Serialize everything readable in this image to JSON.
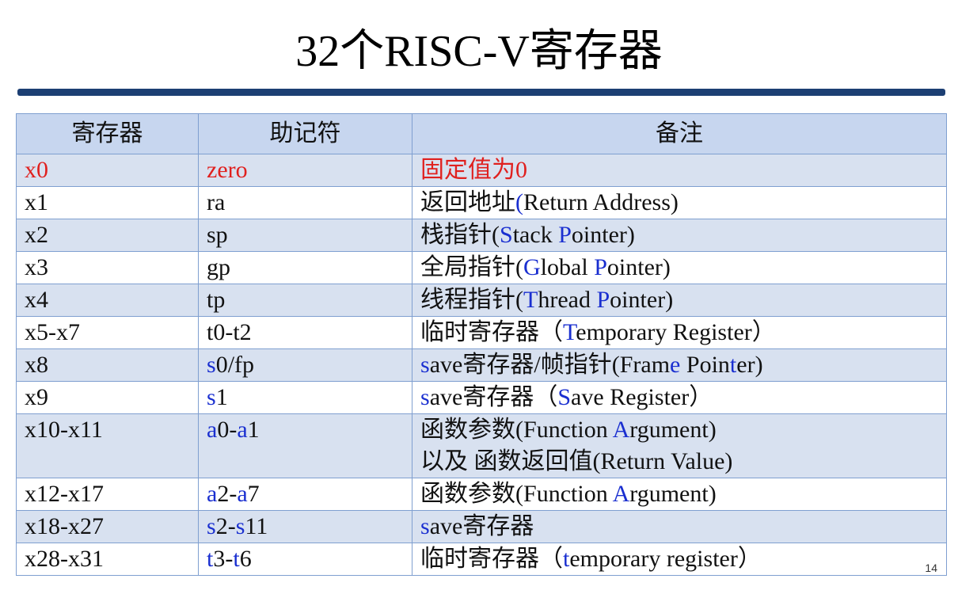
{
  "title": "32个RISC-V寄存器",
  "table": {
    "headers": [
      "寄存器",
      "助记符",
      "备注"
    ],
    "rows": [
      {
        "reg": "x0",
        "mnemonic": "zero",
        "note": "固定值为0"
      },
      {
        "reg": "x1",
        "mnemonic": "ra",
        "note": "返回地址(Return Address)"
      },
      {
        "reg": "x2",
        "mnemonic": "sp",
        "note": "栈指针(Stack Pointer)"
      },
      {
        "reg": "x3",
        "mnemonic": "gp",
        "note": "全局指针(Global Pointer)"
      },
      {
        "reg": "x4",
        "mnemonic": "tp",
        "note": "线程指针(Thread Pointer)"
      },
      {
        "reg": "x5-x7",
        "mnemonic": "t0-t2",
        "note": "临时寄存器（Temporary Register）"
      },
      {
        "reg": "x8",
        "mnemonic": "s0/fp",
        "note": "save寄存器/帧指针(Frame Pointer)"
      },
      {
        "reg": "x9",
        "mnemonic": "s1",
        "note": "save寄存器（Save Register）"
      },
      {
        "reg": "x10-x11",
        "mnemonic": "a0-a1",
        "note": "函数参数(Function Argument)",
        "note2": "以及 函数返回值(Return Value)"
      },
      {
        "reg": "x12-x17",
        "mnemonic": "a2-a7",
        "note": "函数参数(Function Argument)"
      },
      {
        "reg": "x18-x27",
        "mnemonic": "s2-s11",
        "note": "save寄存器"
      },
      {
        "reg": "x28-x31",
        "mnemonic": "t3-t6",
        "note": "临时寄存器（temporary register）"
      }
    ]
  },
  "page_number": "14",
  "colors": {
    "title_rule": "#1c3f73",
    "header_bg": "#c7d6ef",
    "stripe_bg": "#d8e1f0",
    "highlight_red": "#e0201e",
    "highlight_blue": "#1a2fd0"
  }
}
